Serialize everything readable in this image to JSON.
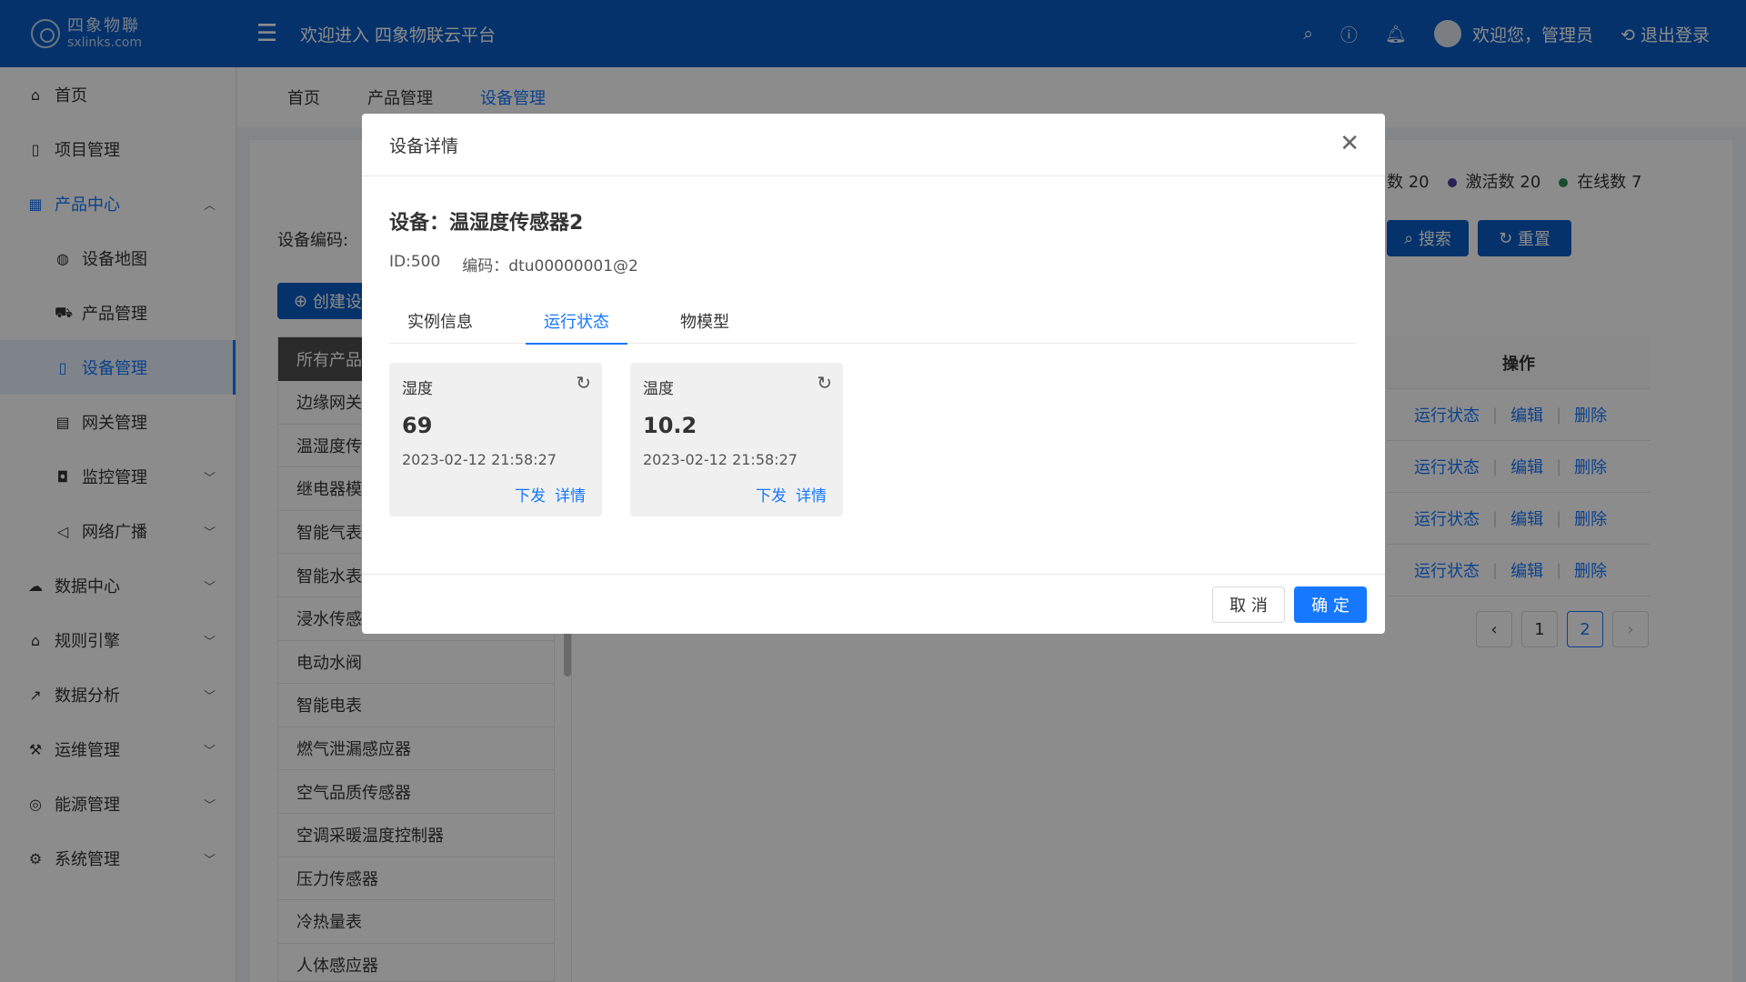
{
  "header": {
    "logo_cn": "四象物聯",
    "logo_en": "sxlinks.com",
    "welcome": "欢迎进入 四象物联云平台",
    "user_greeting": "欢迎您，管理员",
    "logout": "退出登录"
  },
  "sidebar": {
    "items": [
      {
        "label": "首页"
      },
      {
        "label": "项目管理"
      },
      {
        "label": "产品中心"
      },
      {
        "label": "设备地图"
      },
      {
        "label": "产品管理"
      },
      {
        "label": "设备管理"
      },
      {
        "label": "网关管理"
      },
      {
        "label": "监控管理"
      },
      {
        "label": "网络广播"
      },
      {
        "label": "数据中心"
      },
      {
        "label": "规则引擎"
      },
      {
        "label": "数据分析"
      },
      {
        "label": "运维管理"
      },
      {
        "label": "能源管理"
      },
      {
        "label": "系统管理"
      }
    ]
  },
  "tabs_bar": [
    "首页",
    "产品管理",
    "设备管理"
  ],
  "content": {
    "filter_label": "设备编码:",
    "create_btn": "创建设",
    "search_btn": "搜索",
    "reset_btn": "重置",
    "stats": {
      "total_label": "数",
      "total_value": "20",
      "activated_label": "激活数",
      "activated_value": "20",
      "online_label": "在线数",
      "online_value": "7"
    },
    "category_head": "所有产品",
    "categories": [
      "边缘网关",
      "温湿度传",
      "继电器模",
      "智能气表",
      "智能水表",
      "浸水传感",
      "电动水阀",
      "智能电表",
      "燃气泄漏感应器",
      "空气品质传感器",
      "空调采暖温度控制器",
      "压力传感器",
      "冷热量表",
      "人体感应器"
    ],
    "table_head_ops": "操作",
    "row_ops": {
      "status": "运行状态",
      "edit": "编辑",
      "delete": "删除"
    },
    "pager": {
      "page1": "1",
      "page2": "2"
    }
  },
  "modal": {
    "title": "设备详情",
    "device_title": "设备：温湿度传感器2",
    "id_text": "ID:500",
    "code_text": "编码：dtu00000001@2",
    "tabs": [
      "实例信息",
      "运行状态",
      "物模型"
    ],
    "cards": [
      {
        "title": "湿度",
        "value": "69",
        "time": "2023-02-12 21:58:27",
        "send": "下发",
        "detail": "详情"
      },
      {
        "title": "温度",
        "value": "10.2",
        "time": "2023-02-12 21:58:27",
        "send": "下发",
        "detail": "详情"
      }
    ],
    "cancel": "取 消",
    "ok": "确 定"
  },
  "colors": {
    "header": "#0a5bc4",
    "accent": "#1677ff",
    "activated_dot": "#4b3f9c",
    "online_dot": "#2e8b57"
  }
}
